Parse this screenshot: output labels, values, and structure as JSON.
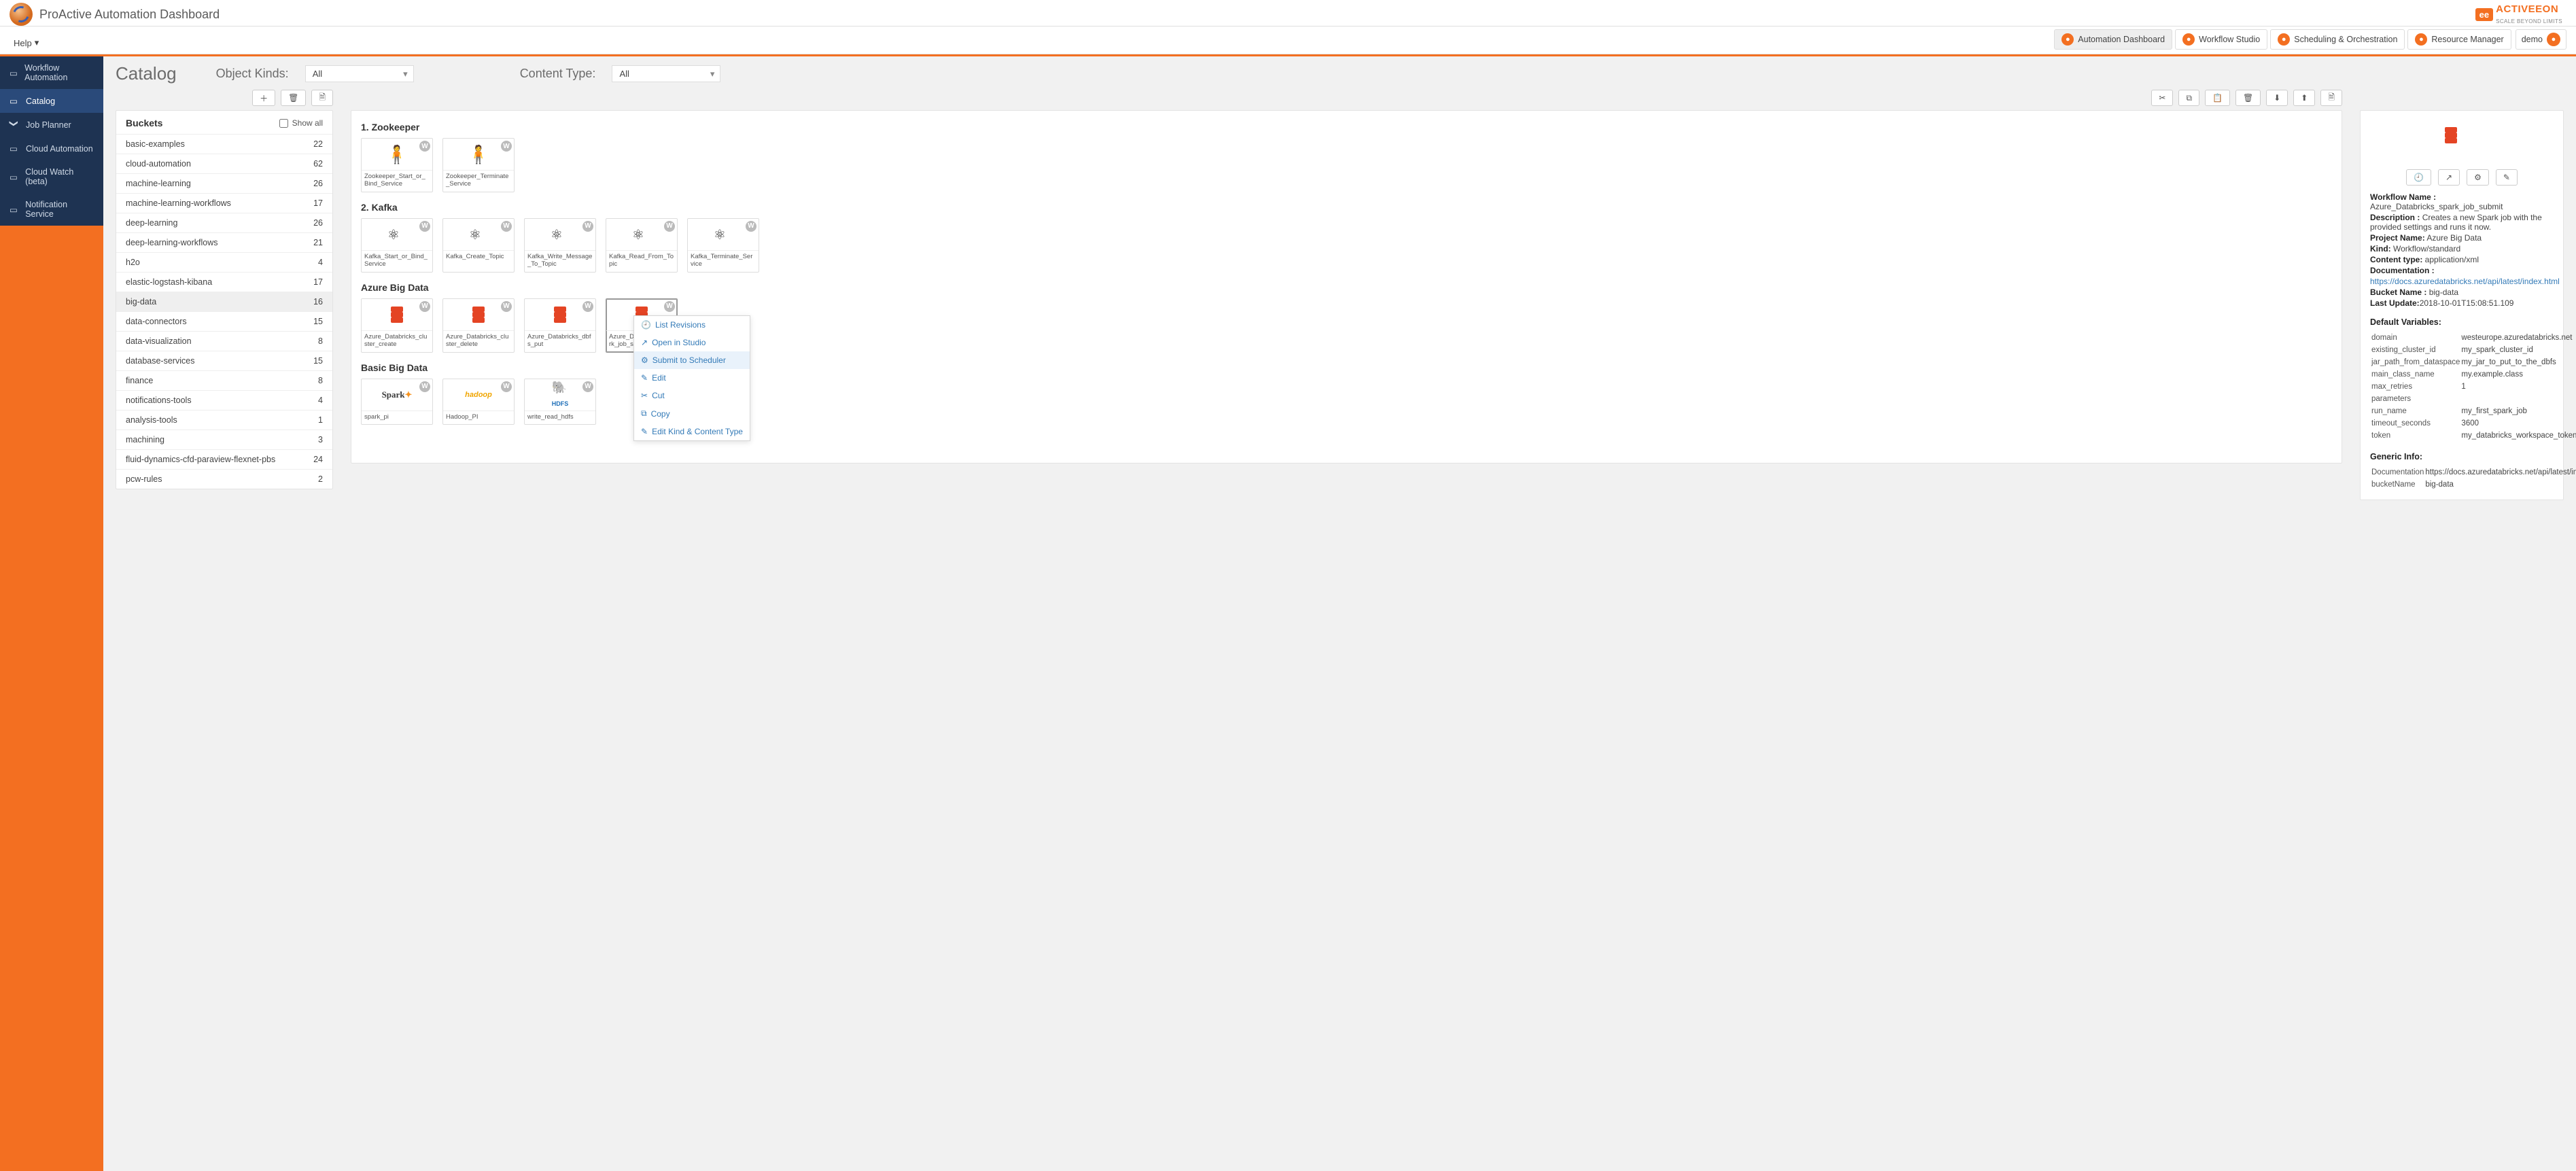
{
  "brand": {
    "title": "ProActive Automation Dashboard"
  },
  "vendor": {
    "badge": "ee",
    "name": "ACTIVEEON",
    "tagline": "SCALE BEYOND LIMITS"
  },
  "topNav": [
    {
      "label": "Automation Dashboard",
      "active": true
    },
    {
      "label": "Workflow Studio"
    },
    {
      "label": "Scheduling & Orchestration"
    },
    {
      "label": "Resource Manager"
    }
  ],
  "user": {
    "name": "demo"
  },
  "helpMenu": "Help",
  "sidebar": {
    "items": [
      {
        "label": "Workflow Automation"
      },
      {
        "label": "Catalog",
        "active": true
      },
      {
        "label": "Job Planner",
        "caret": true
      },
      {
        "label": "Cloud Automation"
      },
      {
        "label": "Cloud Watch (beta)"
      },
      {
        "label": "Notification Service"
      }
    ]
  },
  "page": {
    "title": "Catalog",
    "objectKindsLabel": "Object Kinds:",
    "objectKindsValue": "All",
    "contentTypeLabel": "Content Type:",
    "contentTypeValue": "All"
  },
  "buckets": {
    "heading": "Buckets",
    "showAll": "Show all",
    "items": [
      {
        "name": "basic-examples",
        "count": 22
      },
      {
        "name": "cloud-automation",
        "count": 62
      },
      {
        "name": "machine-learning",
        "count": 26
      },
      {
        "name": "machine-learning-workflows",
        "count": 17
      },
      {
        "name": "deep-learning",
        "count": 26
      },
      {
        "name": "deep-learning-workflows",
        "count": 21
      },
      {
        "name": "h2o",
        "count": 4
      },
      {
        "name": "elastic-logstash-kibana",
        "count": 17
      },
      {
        "name": "big-data",
        "count": 16,
        "selected": true
      },
      {
        "name": "data-connectors",
        "count": 15
      },
      {
        "name": "data-visualization",
        "count": 8
      },
      {
        "name": "database-services",
        "count": 15
      },
      {
        "name": "finance",
        "count": 8
      },
      {
        "name": "notifications-tools",
        "count": 4
      },
      {
        "name": "analysis-tools",
        "count": 1
      },
      {
        "name": "machining",
        "count": 3
      },
      {
        "name": "fluid-dynamics-cfd-paraview-flexnet-pbs",
        "count": 24
      },
      {
        "name": "pcw-rules",
        "count": 2
      }
    ]
  },
  "groups": [
    {
      "title": "1. Zookeeper",
      "icon": "man",
      "cards": [
        {
          "label": "Zookeeper_Start_or_Bind_Service"
        },
        {
          "label": "Zookeeper_Terminate_Service"
        }
      ]
    },
    {
      "title": "2. Kafka",
      "icon": "graph",
      "cards": [
        {
          "label": "Kafka_Start_or_Bind_Service"
        },
        {
          "label": "Kafka_Create_Topic"
        },
        {
          "label": "Kafka_Write_Message_To_Topic"
        },
        {
          "label": "Kafka_Read_From_Topic"
        },
        {
          "label": "Kafka_Terminate_Service"
        }
      ]
    },
    {
      "title": "Azure Big Data",
      "icon": "stack",
      "cards": [
        {
          "label": "Azure_Databricks_cluster_create"
        },
        {
          "label": "Azure_Databricks_cluster_delete"
        },
        {
          "label": "Azure_Databricks_dbfs_put"
        },
        {
          "label": "Azure_Databricks_spark_job_submit",
          "selected": true
        }
      ]
    },
    {
      "title": "Basic Big Data",
      "icon": "mixed",
      "cards": [
        {
          "label": "spark_pi",
          "thumb": "spark"
        },
        {
          "label": "Hadoop_PI",
          "thumb": "hadoop"
        },
        {
          "label": "write_read_hdfs",
          "thumb": "hdfs"
        }
      ]
    }
  ],
  "contextMenu": {
    "items": [
      {
        "icon": "🕘",
        "label": "List Revisions"
      },
      {
        "icon": "↗",
        "label": "Open in Studio"
      },
      {
        "icon": "⚙",
        "label": "Submit to Scheduler",
        "highlight": true
      },
      {
        "icon": "✎",
        "label": "Edit"
      },
      {
        "icon": "✂",
        "label": "Cut"
      },
      {
        "icon": "⧉",
        "label": "Copy"
      },
      {
        "icon": "✎",
        "label": "Edit Kind & Content Type"
      }
    ]
  },
  "details": {
    "workflowNameLabel": "Workflow Name :",
    "workflowName": "Azure_Databricks_spark_job_submit",
    "descriptionLabel": "Description :",
    "description": "Creates a new Spark job with the provided settings and runs it now.",
    "projectNameLabel": "Project Name:",
    "projectName": "Azure Big Data",
    "kindLabel": "Kind:",
    "kind": "Workflow/standard",
    "contentTypeLabel": "Content type:",
    "contentType": "application/xml",
    "documentationLabel": "Documentation :",
    "documentationLink": "https://docs.azuredatabricks.net/api/latest/index.html",
    "bucketNameLabel": "Bucket Name :",
    "bucketName": "big-data",
    "lastUpdateLabel": "Last Update:",
    "lastUpdate": "2018-10-01T15:08:51.109",
    "defaultVarsTitle": "Default Variables:",
    "vars": [
      {
        "k": "domain",
        "v": "westeurope.azuredatabricks.net"
      },
      {
        "k": "existing_cluster_id",
        "v": "my_spark_cluster_id"
      },
      {
        "k": "jar_path_from_dataspace",
        "v": "my_jar_to_put_to_the_dbfs"
      },
      {
        "k": "main_class_name",
        "v": "my.example.class"
      },
      {
        "k": "max_retries",
        "v": "1"
      },
      {
        "k": "parameters",
        "v": ""
      },
      {
        "k": "run_name",
        "v": "my_first_spark_job"
      },
      {
        "k": "timeout_seconds",
        "v": "3600"
      },
      {
        "k": "token",
        "v": "my_databricks_workspace_token"
      }
    ],
    "genericInfoTitle": "Generic Info:",
    "generic": [
      {
        "k": "Documentation",
        "v": "https://docs.azuredatabricks.net/api/latest/index.html"
      },
      {
        "k": "bucketName",
        "v": "big-data"
      }
    ]
  }
}
